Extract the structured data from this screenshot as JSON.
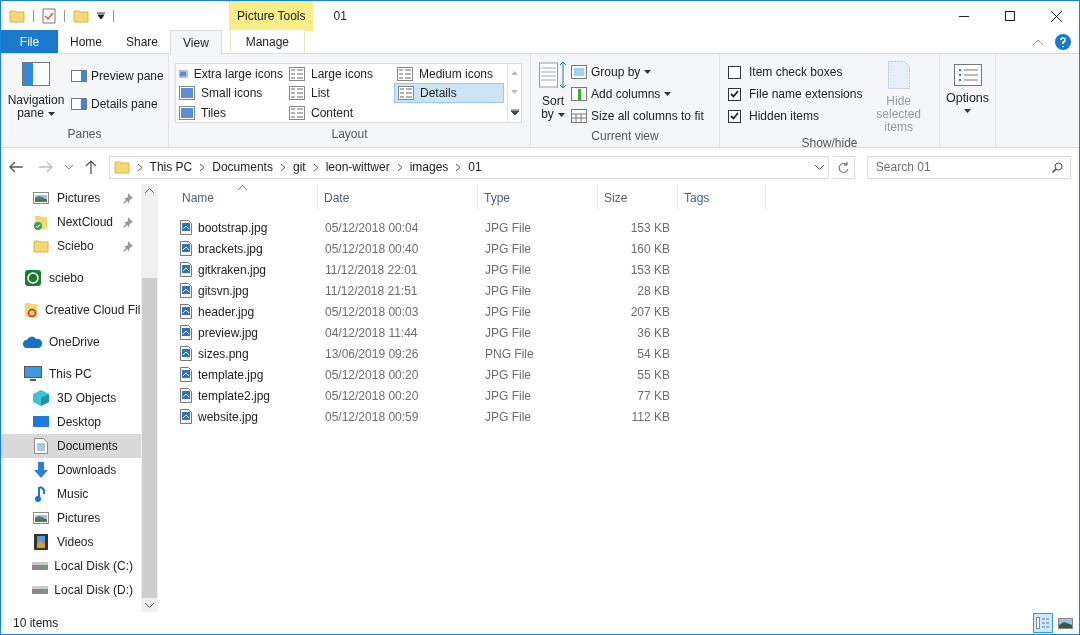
{
  "window": {
    "title": "01",
    "context_tab": "Picture Tools"
  },
  "quick_access": [
    {
      "kind": "folder"
    },
    {
      "kind": "properties"
    },
    {
      "kind": "folder"
    }
  ],
  "ribbon_tabs": [
    {
      "label": "File",
      "kind": "file",
      "selected": false
    },
    {
      "label": "Home",
      "kind": "tab",
      "selected": false
    },
    {
      "label": "Share",
      "kind": "tab",
      "selected": false
    },
    {
      "label": "View",
      "kind": "tab",
      "selected": true
    },
    {
      "label": "Manage",
      "kind": "context",
      "selected": false
    }
  ],
  "panes": {
    "navigation": "Navigation",
    "navigation_2": "pane",
    "preview": "Preview pane",
    "details": "Details pane",
    "group": "Panes"
  },
  "layout": {
    "group": "Layout",
    "items": [
      {
        "label": "Extra large icons",
        "selected": false
      },
      {
        "label": "Large icons",
        "selected": false
      },
      {
        "label": "Medium icons",
        "selected": false
      },
      {
        "label": "Small icons",
        "selected": false
      },
      {
        "label": "List",
        "selected": false
      },
      {
        "label": "Details",
        "selected": true
      },
      {
        "label": "Tiles",
        "selected": false
      },
      {
        "label": "Content",
        "selected": false
      }
    ]
  },
  "current_view": {
    "group": "Current view",
    "sort": "Sort",
    "sort_2": "by",
    "group_by": "Group by",
    "add_columns": "Add columns",
    "size_columns": "Size all columns to fit"
  },
  "show_hide": {
    "group": "Show/hide",
    "checkboxes": [
      {
        "label": "Item check boxes",
        "checked": false
      },
      {
        "label": "File name extensions",
        "checked": true
      },
      {
        "label": "Hidden items",
        "checked": true
      }
    ],
    "hide_selected": "Hide selected",
    "hide_selected_2": "items"
  },
  "options": {
    "label": "Options"
  },
  "address": {
    "crumbs": [
      "This PC",
      "Documents",
      "git",
      "leon-wittwer",
      "images",
      "01"
    ],
    "search_placeholder": "Search 01"
  },
  "sidebar": [
    {
      "label": "Pictures",
      "kind": "pictures",
      "pinned": true,
      "selected": false
    },
    {
      "label": "NextCloud",
      "kind": "synced",
      "pinned": true,
      "selected": false
    },
    {
      "label": "Sciebo",
      "kind": "folder",
      "pinned": true,
      "selected": false
    },
    {
      "label": "sciebo",
      "kind": "app",
      "pinned": false,
      "selected": false
    },
    {
      "label": "Creative Cloud Fil",
      "kind": "cloudfolder",
      "pinned": false,
      "selected": false
    },
    {
      "label": "OneDrive",
      "kind": "cloud",
      "pinned": false,
      "selected": false
    },
    {
      "label": "This PC",
      "kind": "pc",
      "pinned": false,
      "selected": false,
      "children": [
        {
          "label": "3D Objects",
          "kind": "cube",
          "selected": false
        },
        {
          "label": "Desktop",
          "kind": "desktop",
          "selected": false
        },
        {
          "label": "Documents",
          "kind": "document",
          "selected": true
        },
        {
          "label": "Downloads",
          "kind": "download",
          "selected": false
        },
        {
          "label": "Music",
          "kind": "music",
          "selected": false
        },
        {
          "label": "Pictures",
          "kind": "pictures",
          "selected": false
        },
        {
          "label": "Videos",
          "kind": "video",
          "selected": false
        },
        {
          "label": "Local Disk (C:)",
          "kind": "disk",
          "selected": false
        },
        {
          "label": "Local Disk (D:)",
          "kind": "disk",
          "selected": false
        }
      ]
    }
  ],
  "table": {
    "columns": [
      "Name",
      "Date",
      "Type",
      "Size",
      "Tags"
    ],
    "rows": [
      {
        "name": "bootstrap.jpg",
        "date": "05/12/2018 00:04",
        "type": "JPG File",
        "size": "153 KB"
      },
      {
        "name": "brackets.jpg",
        "date": "05/12/2018 00:40",
        "type": "JPG File",
        "size": "160 KB"
      },
      {
        "name": "gitkraken.jpg",
        "date": "11/12/2018 22:01",
        "type": "JPG File",
        "size": "153 KB"
      },
      {
        "name": "gitsvn.jpg",
        "date": "11/12/2018 21:51",
        "type": "JPG File",
        "size": "28 KB"
      },
      {
        "name": "header.jpg",
        "date": "05/12/2018 00:03",
        "type": "JPG File",
        "size": "207 KB"
      },
      {
        "name": "preview.jpg",
        "date": "04/12/2018 11:44",
        "type": "JPG File",
        "size": "36 KB"
      },
      {
        "name": "sizes.png",
        "date": "13/06/2019 09:26",
        "type": "PNG File",
        "size": "54 KB"
      },
      {
        "name": "template.jpg",
        "date": "05/12/2018 00:20",
        "type": "JPG File",
        "size": "55 KB"
      },
      {
        "name": "template2.jpg",
        "date": "05/12/2018 00:20",
        "type": "JPG File",
        "size": "77 KB"
      },
      {
        "name": "website.jpg",
        "date": "05/12/2018 00:59",
        "type": "JPG File",
        "size": "112 KB"
      }
    ]
  },
  "status_bar": {
    "count": "10 items",
    "views": [
      {
        "kind": "details",
        "selected": true
      },
      {
        "kind": "large",
        "selected": false
      }
    ]
  }
}
